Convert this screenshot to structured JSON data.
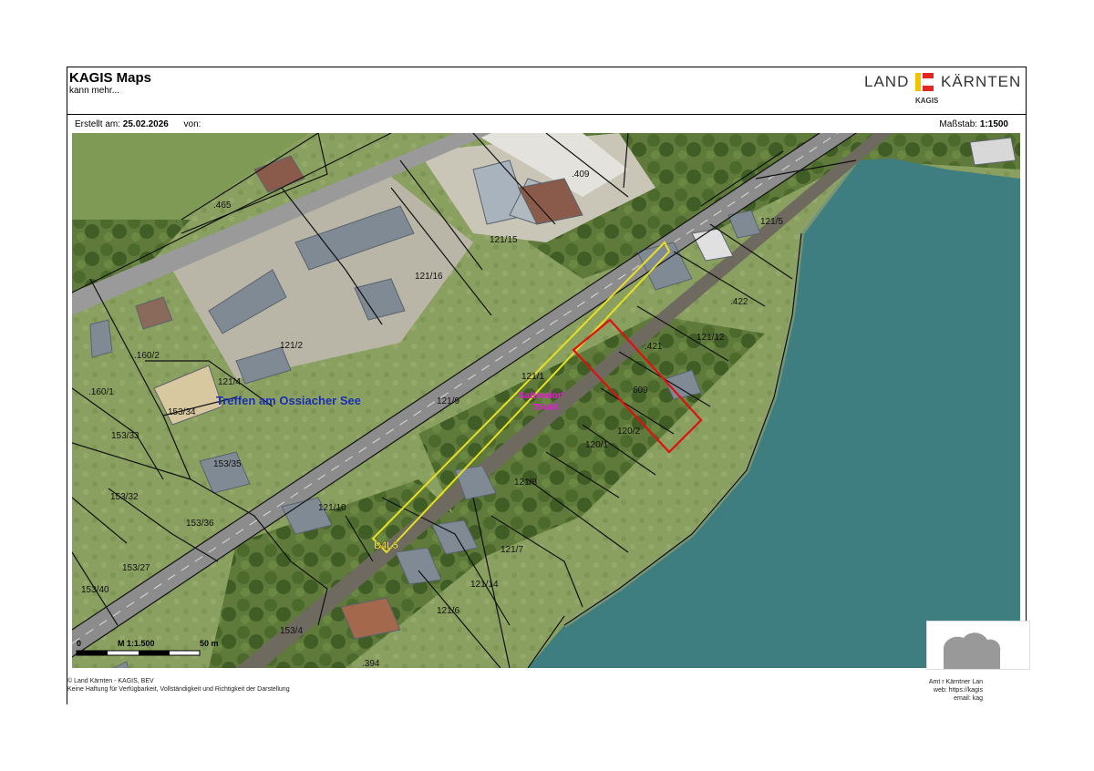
{
  "header": {
    "title": "KAGIS Maps",
    "subtitle": "kann mehr...",
    "logo_left": "LAND",
    "logo_right": "KÄRNTEN",
    "logo_sub": "KAGIS"
  },
  "info": {
    "created_label": "Erstellt am:",
    "created_date": "25.02.2026",
    "by_label": "von:",
    "scale_label": "Maßstab:",
    "scale_value": "1:1500"
  },
  "map": {
    "town_label": "Treffen am Ossiacher See",
    "kg_name": "Sattendorf",
    "kg_number": "75444",
    "road_label": "B4L5",
    "parcels": [
      ".465",
      "121/15",
      ".409",
      "121/16",
      "121/5",
      ".422",
      ".160/2",
      "121/2",
      ".421",
      "121/12",
      ".160/1",
      "121/4",
      "121/1",
      "609",
      "121/9",
      "153/34",
      "120/2",
      "153/33",
      "120/1",
      "153/35",
      "121/8",
      "153/32",
      "153/36",
      "121/10",
      "153/27",
      "121/7",
      "121/14",
      "153/40",
      "121/6",
      "153/4",
      ".394"
    ],
    "scalebar": {
      "zero": "0",
      "scale": "M 1:1.500",
      "end": "50 m"
    },
    "colors": {
      "selected_parcel": "#e01010",
      "road_parcel": "#e8e020",
      "lake": "#3f7e80"
    }
  },
  "footer": {
    "copyright": "© Land Kärnten - KAGIS, BEV",
    "disclaimer": "Keine Haftung für Verfügbarkeit, Vollständigkeit und Richtigkeit der Darstellung",
    "right_1": "Amt  r Kärntner Lan",
    "right_2": "web: https://kagis",
    "right_3": "email: kag"
  }
}
